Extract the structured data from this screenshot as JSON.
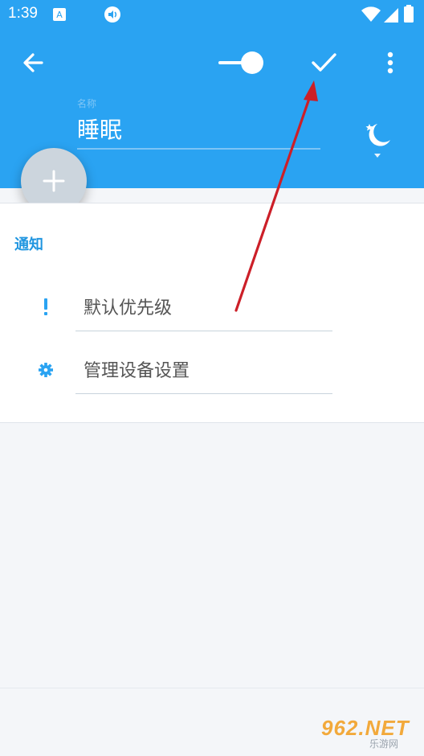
{
  "status_bar": {
    "time": "1:39",
    "icons": [
      "keyboard-a-icon",
      "volume-icon",
      "wifi-icon",
      "signal-icon",
      "battery-icon"
    ]
  },
  "toolbar": {
    "back_icon": "arrow-left-icon",
    "toggle_icon": "toggle-switch-icon",
    "confirm_icon": "checkmark-icon",
    "more_icon": "more-vert-icon",
    "accent_color": "#2aa3f2"
  },
  "name_field": {
    "label": "名称",
    "value": "睡眠"
  },
  "mode_icon": "moon-stars-icon",
  "fab": {
    "icon": "plus-icon"
  },
  "notifications": {
    "section_title": "通知",
    "items": [
      {
        "label": "默认优先级",
        "icon": "exclamation-icon"
      },
      {
        "label": "管理设备设置",
        "icon": "gear-icon"
      }
    ]
  },
  "watermark": {
    "text": "962.NET",
    "sub": "乐游网"
  }
}
